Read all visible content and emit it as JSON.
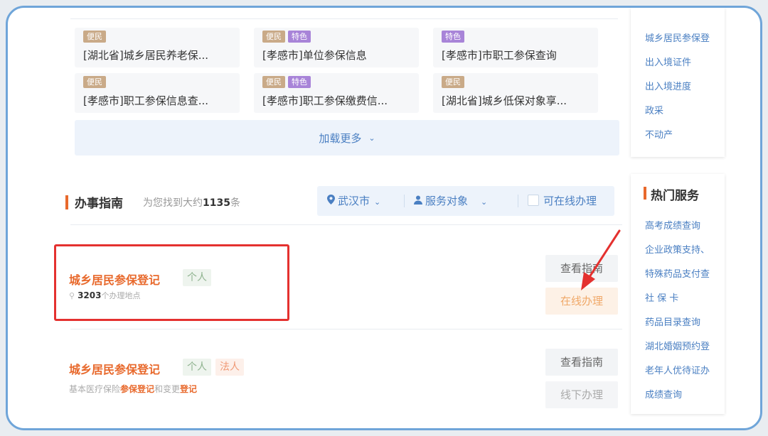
{
  "cards": [
    {
      "badges": [
        {
          "label": "便民",
          "kind": "conv"
        }
      ],
      "title": "[湖北省]城乡居民养老保..."
    },
    {
      "badges": [
        {
          "label": "便民",
          "kind": "conv"
        },
        {
          "label": "特色",
          "kind": "feat"
        }
      ],
      "title": "[孝感市]单位参保信息"
    },
    {
      "badges": [
        {
          "label": "特色",
          "kind": "feat"
        }
      ],
      "title": "[孝感市]市职工参保查询"
    },
    {
      "badges": [
        {
          "label": "便民",
          "kind": "conv"
        }
      ],
      "title": "[孝感市]职工参保信息查..."
    },
    {
      "badges": [
        {
          "label": "便民",
          "kind": "conv"
        },
        {
          "label": "特色",
          "kind": "feat"
        }
      ],
      "title": "[孝感市]职工参保缴费信..."
    },
    {
      "badges": [
        {
          "label": "便民",
          "kind": "conv"
        }
      ],
      "title": "[湖北省]城乡低保对象享..."
    }
  ],
  "load_more": "加载更多",
  "guide": {
    "title": "办事指南",
    "count_prefix": "为您找到大约",
    "count": "1135",
    "count_suffix": "条",
    "filters": {
      "city": "武汉市",
      "service_target": "服务对象",
      "online_only": "可在线办理"
    }
  },
  "results": [
    {
      "title": "城乡居民参保登记",
      "tag_personal": "个人",
      "location_count": "3203",
      "location_suffix": "个办理地点",
      "btn_view": "查看指南",
      "btn_action": "在线办理"
    },
    {
      "title": "城乡居民参保登记",
      "tag_personal": "个人",
      "tag_legal": "法人",
      "desc_prefix": "基本医疗保险",
      "desc_hl1": "参保登记",
      "desc_mid": "和变更",
      "desc_hl2": "登记",
      "btn_view": "查看指南",
      "btn_action": "线下办理"
    }
  ],
  "sidebar_top": [
    "城乡居民参保登",
    "出入境证件",
    "出入境进度",
    "政采",
    "不动产"
  ],
  "hot_services": {
    "title": "热门服务",
    "items": [
      "高考成绩查询",
      "企业政策支持、",
      "特殊药品支付查",
      "社 保 卡",
      "药品目录查询",
      "湖北婚姻预约登",
      "老年人优待证办",
      "成绩查询"
    ]
  },
  "colors": {
    "accent": "#e8692c",
    "link": "#4a7fc2",
    "annotation_red": "#e4312f",
    "frame_border": "#6fa5d9"
  }
}
